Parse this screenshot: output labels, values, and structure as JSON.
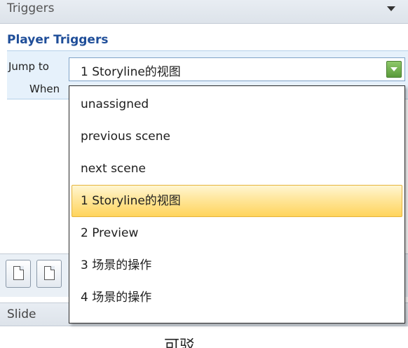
{
  "panel": {
    "title": "Triggers"
  },
  "player_triggers": {
    "section_title": "Player Triggers",
    "trigger_line1_prefix": "Jump to",
    "trigger_line2_prefix": "When"
  },
  "select": {
    "selected_value": "1 Storyline的视图",
    "options": [
      "unassigned",
      "previous scene",
      "next scene",
      "1 Storyline的视图",
      "2 Preview",
      "3 场景的操作",
      "4 场景的操作"
    ],
    "highlighted_option": "1 Storyline的视图"
  },
  "bottom": {
    "slide_label": "Slide",
    "partial_text": "可驳"
  },
  "colors": {
    "section_title": "#1f4e99",
    "trigger_background": "#e6f1fb",
    "highlight": "#ffe69a",
    "arrow_button": "#6aaa44"
  }
}
